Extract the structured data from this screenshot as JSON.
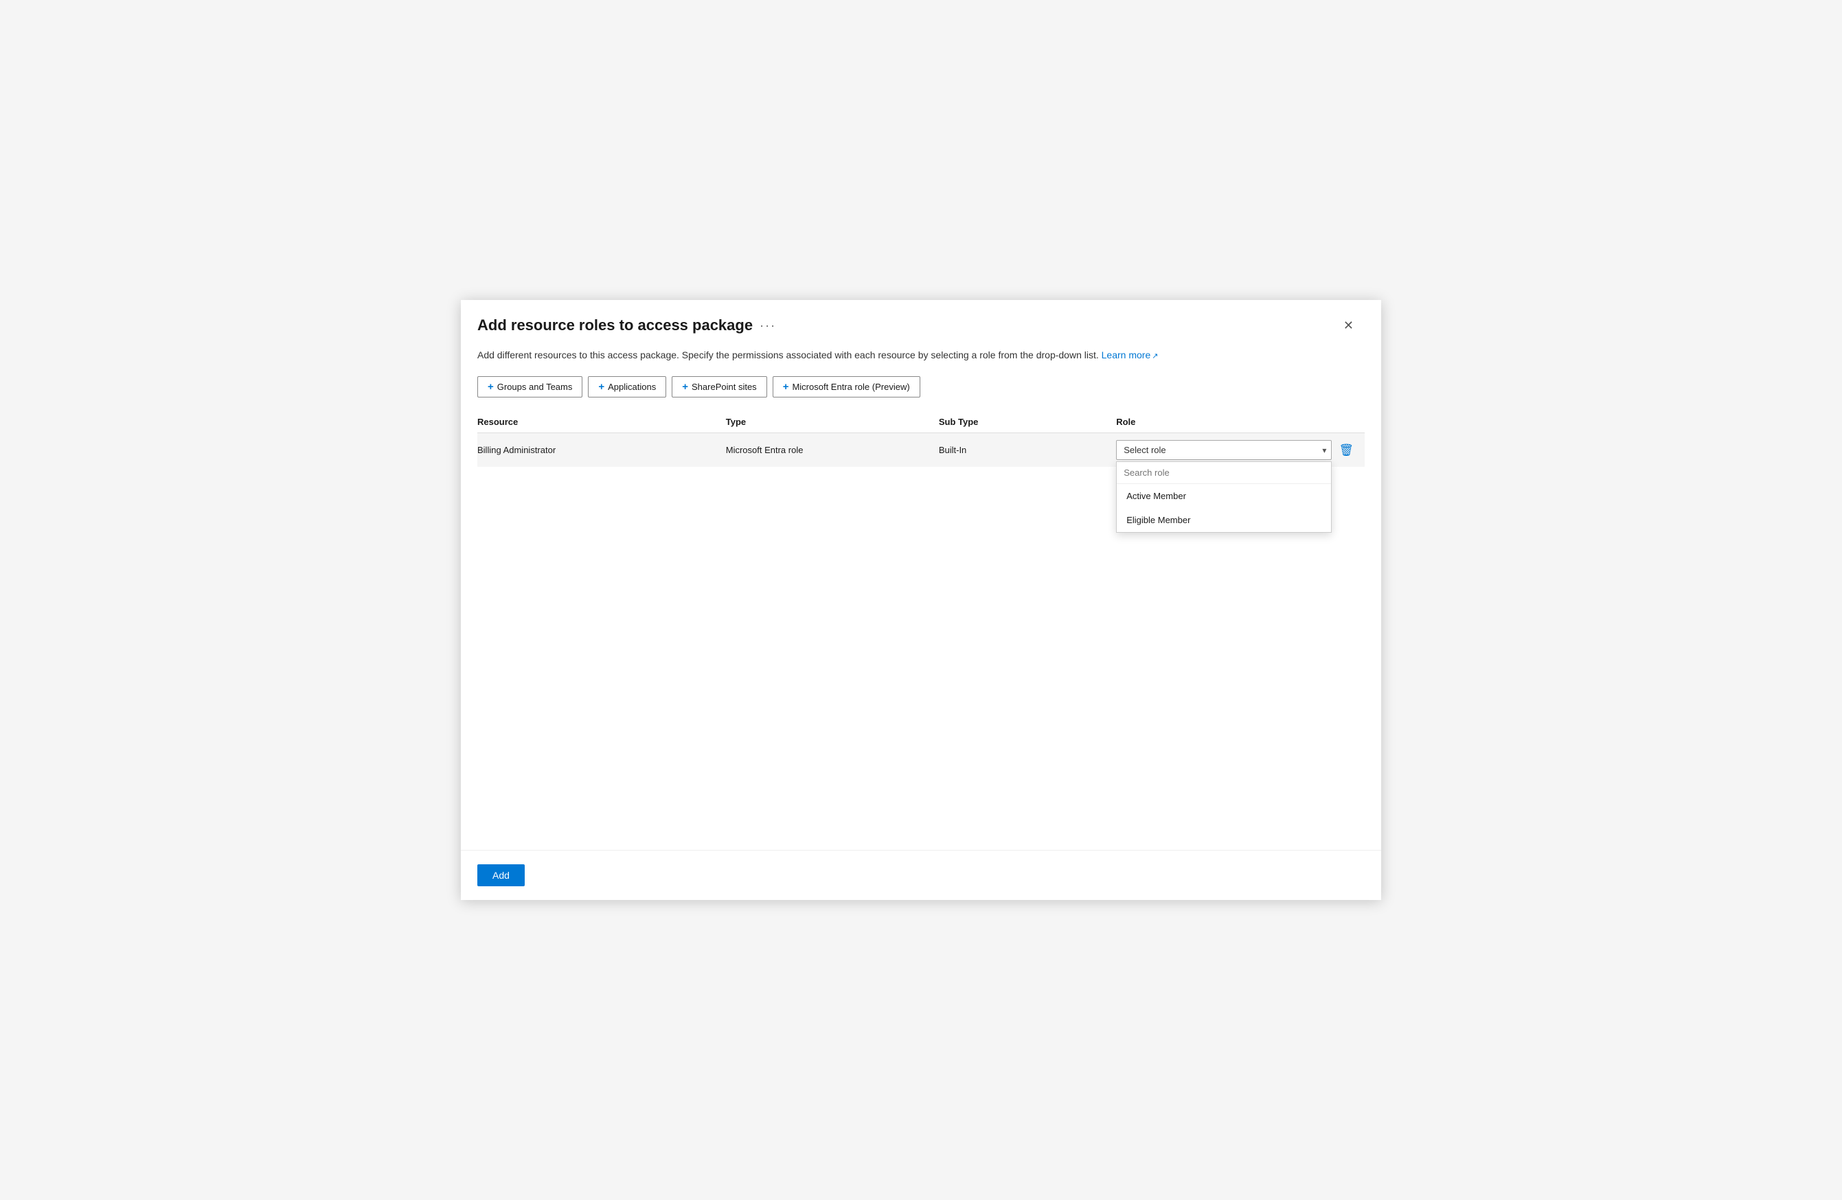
{
  "dialog": {
    "title": "Add resource roles to access package",
    "more_icon": "···",
    "description": "Add different resources to this access package. Specify the permissions associated with each resource by selecting a role from the drop-down list.",
    "learn_more_text": "Learn more",
    "close_label": "✕"
  },
  "buttons": [
    {
      "id": "groups-and-teams",
      "label": "Groups and Teams"
    },
    {
      "id": "applications",
      "label": "Applications"
    },
    {
      "id": "sharepoint-sites",
      "label": "SharePoint sites"
    },
    {
      "id": "microsoft-entra-role",
      "label": "Microsoft Entra role (Preview)"
    }
  ],
  "table": {
    "columns": [
      {
        "id": "resource",
        "label": "Resource"
      },
      {
        "id": "type",
        "label": "Type"
      },
      {
        "id": "subtype",
        "label": "Sub Type"
      },
      {
        "id": "role",
        "label": "Role"
      }
    ],
    "rows": [
      {
        "resource": "Billing Administrator",
        "type": "Microsoft Entra role",
        "subtype": "Built-In",
        "role_placeholder": "Select role"
      }
    ]
  },
  "role_dropdown": {
    "search_placeholder": "Search role",
    "options": [
      {
        "label": "Active Member"
      },
      {
        "label": "Eligible Member"
      }
    ]
  },
  "footer": {
    "add_button_label": "Add"
  }
}
